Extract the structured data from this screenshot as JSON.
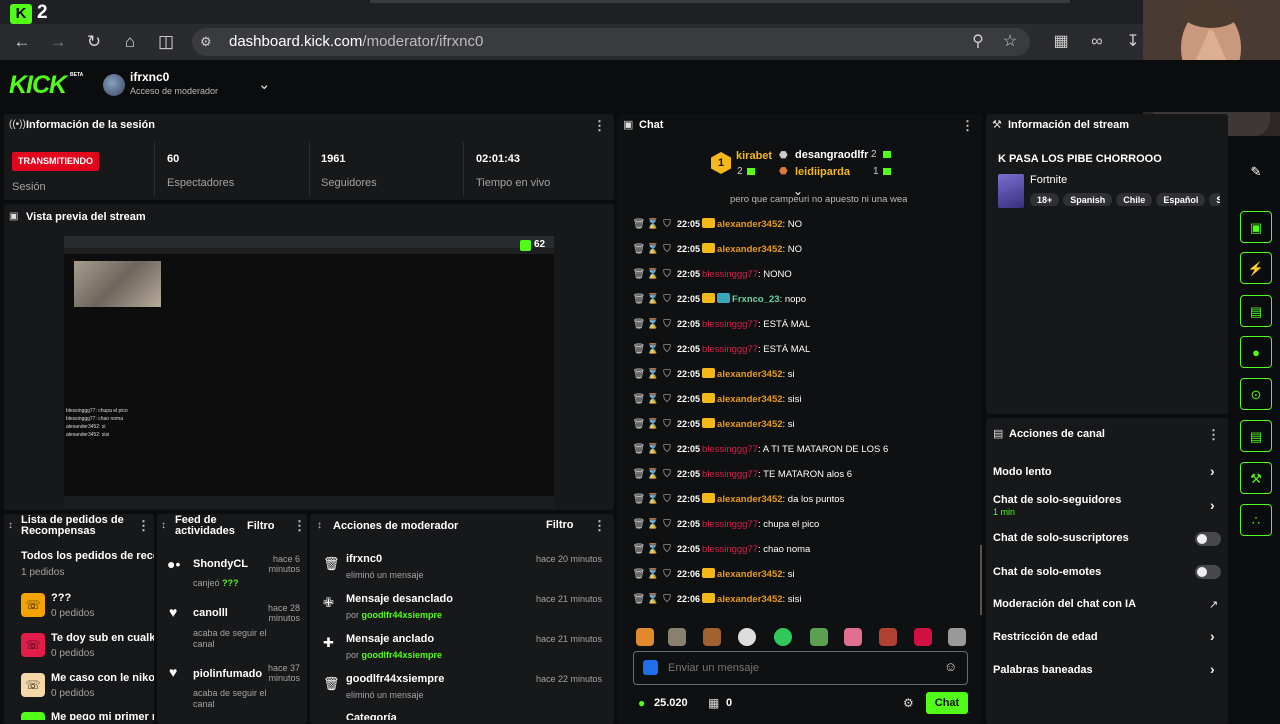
{
  "browser": {
    "tab_count": "2",
    "url_host": "dashboard.kick.com",
    "url_path": "/moderator/ifrxnc0"
  },
  "header": {
    "logo": "KICK",
    "beta": "BETA",
    "channel": "ifrxnc0",
    "role": "Acceso de moderador"
  },
  "session": {
    "title": "Información de la sesión",
    "live": "TRANSMITIENDO",
    "session_label": "Sesión",
    "viewers": "60",
    "viewers_label": "Espectadores",
    "followers": "1961",
    "followers_label": "Seguidores",
    "live_time": "02:01:43",
    "live_time_label": "Tiempo en vivo"
  },
  "preview": {
    "title": "Vista previa del stream",
    "viewer_count": "62",
    "chat_lines": [
      "blessinggg77: chupa el pico",
      "blessinggg77: chao noma",
      "alexander3452: si",
      "alexander3452: sisi"
    ]
  },
  "rewards": {
    "title": "Lista de pedidos de Recompensas",
    "all_title": "Todos los pedidos de reco",
    "all_count": "1 pedidos",
    "items": [
      {
        "name": "???",
        "count": "0 pedidos",
        "color": "#f5a300"
      },
      {
        "name": "Te doy sub en cualki",
        "count": "0 pedidos",
        "color": "#e11d48"
      },
      {
        "name": "Me caso con le nikot",
        "count": "0 pedidos",
        "color": "#f5d7a8"
      },
      {
        "name": "Me pego mi primer p",
        "count": "",
        "color": "#53fc18"
      }
    ]
  },
  "feed": {
    "title": "Feed de actividades",
    "filter": "Filtro",
    "items": [
      {
        "user": "ShondyCL",
        "time": "hace 6 minutos",
        "action": "canjeó",
        "extra": "???"
      },
      {
        "user": "canolll",
        "time": "hace 28 minutos",
        "action": "acaba de seguir el canal",
        "extra": ""
      },
      {
        "user": "piolinfumado",
        "time": "hace 37 minutos",
        "action": "acaba de seguir el canal",
        "extra": ""
      }
    ]
  },
  "modactions": {
    "title": "Acciones de moderador",
    "filter": "Filtro",
    "items": [
      {
        "title": "ifrxnc0",
        "time": "hace 20 minutos",
        "sub": "eliminó un mensaje",
        "by": ""
      },
      {
        "title": "Mensaje desanclado",
        "time": "hace 21 minutos",
        "sub": "por",
        "by": "goodlfr44xsiempre"
      },
      {
        "title": "Mensaje anclado",
        "time": "hace 21 minutos",
        "sub": "por",
        "by": "goodlfr44xsiempre"
      },
      {
        "title": "goodlfr44xsiempre",
        "time": "hace 22 minutos",
        "sub": "eliminó un mensaje",
        "by": ""
      },
      {
        "title": "Categoría",
        "time": "",
        "sub": "",
        "by": ""
      }
    ]
  },
  "chat": {
    "title": "Chat",
    "top": [
      {
        "rank": "1",
        "name": "kirabet",
        "count": "2"
      },
      {
        "rank": "",
        "name": "desangraodlfr",
        "count": "2"
      },
      {
        "rank": "",
        "name": "leidiiparda",
        "count": "1"
      }
    ],
    "partial": "pero que campeuri no apuesto ni una wea",
    "messages": [
      {
        "time": "22:05",
        "user": "alexander3452",
        "text": ": NO",
        "style": "gold"
      },
      {
        "time": "22:05",
        "user": "alexander3452",
        "text": ": NO",
        "style": "gold"
      },
      {
        "time": "22:05",
        "user": "blessinggg77",
        "text": ": NONO",
        "style": "red"
      },
      {
        "time": "22:05",
        "user": "Frxnco_23",
        "text": ": nopo",
        "style": "teal"
      },
      {
        "time": "22:05",
        "user": "blessinggg77",
        "text": ": ESTÁ MAL",
        "style": "red"
      },
      {
        "time": "22:05",
        "user": "blessinggg77",
        "text": ": ESTÁ MAL",
        "style": "red"
      },
      {
        "time": "22:05",
        "user": "alexander3452",
        "text": ": si",
        "style": "gold"
      },
      {
        "time": "22:05",
        "user": "alexander3452",
        "text": ": sisi",
        "style": "gold"
      },
      {
        "time": "22:05",
        "user": "alexander3452",
        "text": ": si",
        "style": "gold"
      },
      {
        "time": "22:05",
        "user": "blessinggg77",
        "text": ": A TI TE MATARON DE LOS 6",
        "style": "red"
      },
      {
        "time": "22:05",
        "user": "blessinggg77",
        "text": ": TE MATARON alos 6",
        "style": "red"
      },
      {
        "time": "22:05",
        "user": "alexander3452",
        "text": ": da los puntos",
        "style": "gold"
      },
      {
        "time": "22:05",
        "user": "blessinggg77",
        "text": ": chupa el pico",
        "style": "red"
      },
      {
        "time": "22:05",
        "user": "blessinggg77",
        "text": ": chao noma",
        "style": "red"
      },
      {
        "time": "22:06",
        "user": "alexander3452",
        "text": ": si",
        "style": "gold"
      },
      {
        "time": "22:06",
        "user": "alexander3452",
        "text": ": sisi",
        "style": "gold"
      }
    ],
    "placeholder": "Enviar un mensaje",
    "points": "25.020",
    "gifts": "0",
    "send": "Chat"
  },
  "streaminfo": {
    "title": "Información del stream",
    "stream_title": "K PASA LOS PIBE CHORROOO",
    "category": "Fortnite",
    "tags": [
      "18+",
      "Spanish",
      "Chile",
      "Español",
      "S"
    ]
  },
  "channelactions": {
    "title": "Acciones de canal",
    "items": [
      {
        "label": "Modo lento",
        "sub": "",
        "kind": "chevron"
      },
      {
        "label": "Chat de solo-seguidores",
        "sub": "1 min",
        "kind": "chevron"
      },
      {
        "label": "Chat de solo-suscriptores",
        "sub": "",
        "kind": "toggle"
      },
      {
        "label": "Chat de solo-emotes",
        "sub": "",
        "kind": "toggle"
      },
      {
        "label": "Moderación del chat con IA",
        "sub": "",
        "kind": "external"
      },
      {
        "label": "Restricción de edad",
        "sub": "",
        "kind": "chevron"
      },
      {
        "label": "Palabras baneadas",
        "sub": "",
        "kind": "chevron"
      }
    ]
  }
}
